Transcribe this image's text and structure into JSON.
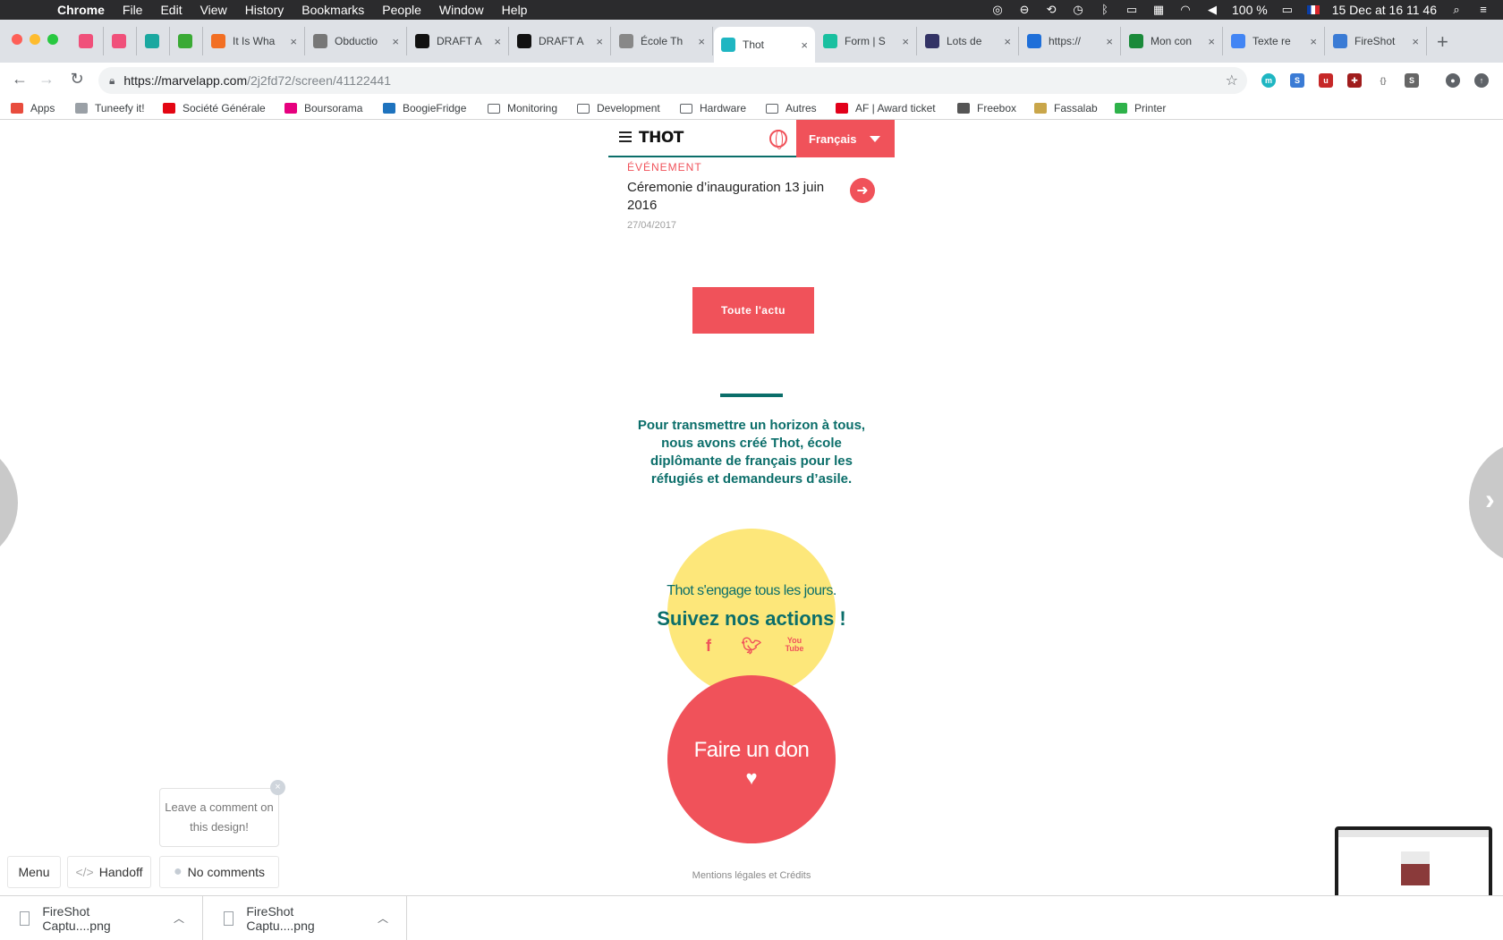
{
  "menubar": {
    "app": "Chrome",
    "items": [
      "File",
      "Edit",
      "View",
      "History",
      "Bookmarks",
      "People",
      "Window",
      "Help"
    ],
    "battery": "100 %",
    "clock": "15 Dec at  16 11 46"
  },
  "tabs": [
    {
      "label": "",
      "icon": "k-icon",
      "color": "#f0507a"
    },
    {
      "label": "",
      "icon": "k-icon",
      "color": "#f0507a"
    },
    {
      "label": "",
      "icon": "trello-icon",
      "color": "#1aa8a0"
    },
    {
      "label": "",
      "icon": "trello-icon",
      "color": "#3aaa35"
    },
    {
      "label": "It Is Wha",
      "icon": "soundcloud-icon",
      "color": "#f26f23"
    },
    {
      "label": "Obductio",
      "icon": "gear-icon",
      "color": "#777777"
    },
    {
      "label": "DRAFT A",
      "icon": "r-icon",
      "color": "#111111"
    },
    {
      "label": "DRAFT A",
      "icon": "r-icon",
      "color": "#111111"
    },
    {
      "label": "École Th",
      "icon": "doc-icon",
      "color": "#888888"
    },
    {
      "label": "Thot",
      "icon": "marvel-icon",
      "color": "#1fb6c2",
      "active": true
    },
    {
      "label": "Form | S",
      "icon": "s-icon",
      "color": "#19c0a0"
    },
    {
      "label": "Lots de",
      "icon": "lots-icon",
      "color": "#333366"
    },
    {
      "label": "https://",
      "icon": "m-icon",
      "color": "#1e6fd9"
    },
    {
      "label": "Mon con",
      "icon": "k-icon",
      "color": "#1a8a3a"
    },
    {
      "label": "Texte re",
      "icon": "docs-icon",
      "color": "#4285f4"
    },
    {
      "label": "FireShot",
      "icon": "fireshot-icon",
      "color": "#3a7bd5"
    }
  ],
  "address": {
    "host": "https://marvelapp.com",
    "path": "/2j2fd72/screen/41122441"
  },
  "bookmarks": [
    {
      "label": "Apps",
      "icon": "apps-icon"
    },
    {
      "label": "Tuneefy it!",
      "icon": "page-icon"
    },
    {
      "label": "Société Générale",
      "icon": "sg-icon"
    },
    {
      "label": "Boursorama",
      "icon": "boursorama-icon"
    },
    {
      "label": "BoogieFridge",
      "icon": "dsm-icon"
    },
    {
      "label": "Monitoring",
      "icon": "folder-icon"
    },
    {
      "label": "Development",
      "icon": "folder-icon"
    },
    {
      "label": "Hardware",
      "icon": "folder-icon"
    },
    {
      "label": "Autres",
      "icon": "folder-icon"
    },
    {
      "label": "AF | Award ticket",
      "icon": "af-icon"
    },
    {
      "label": "Freebox",
      "icon": "freebox-icon"
    },
    {
      "label": "Fassalab",
      "icon": "fassalab-icon"
    },
    {
      "label": "Printer",
      "icon": "printer-icon"
    }
  ],
  "site": {
    "logo": "THOT",
    "language": "Français",
    "news": {
      "category": "ÉVÉNEMENT",
      "title": "Céremonie d’inauguration 13 juin 2016",
      "date": "27/04/2017"
    },
    "all_news_button": "Toute l'actu",
    "mission": "Pour transmettre un horizon à tous, nous avons créé Thot, école diplômante de français pour les réfugiés et demandeurs d’asile.",
    "engage_line": "Thot s'engage tous les jours.",
    "follow_line": "Suivez nos actions !",
    "youtube_label": "You Tube",
    "donate": "Faire un don",
    "footer_link": "Mentions légales et Crédits",
    "colors": {
      "teal": "#0b6e6a",
      "coral": "#f0525a",
      "yellow": "#fde77a"
    }
  },
  "marvel": {
    "comment_tooltip": "Leave a comment on this design!",
    "menu_button": "Menu",
    "handoff_button": "Handoff",
    "comments_button": "No comments"
  },
  "downloads": [
    {
      "name": "FireShot Captu....png"
    },
    {
      "name": "FireShot Captu....png"
    }
  ]
}
